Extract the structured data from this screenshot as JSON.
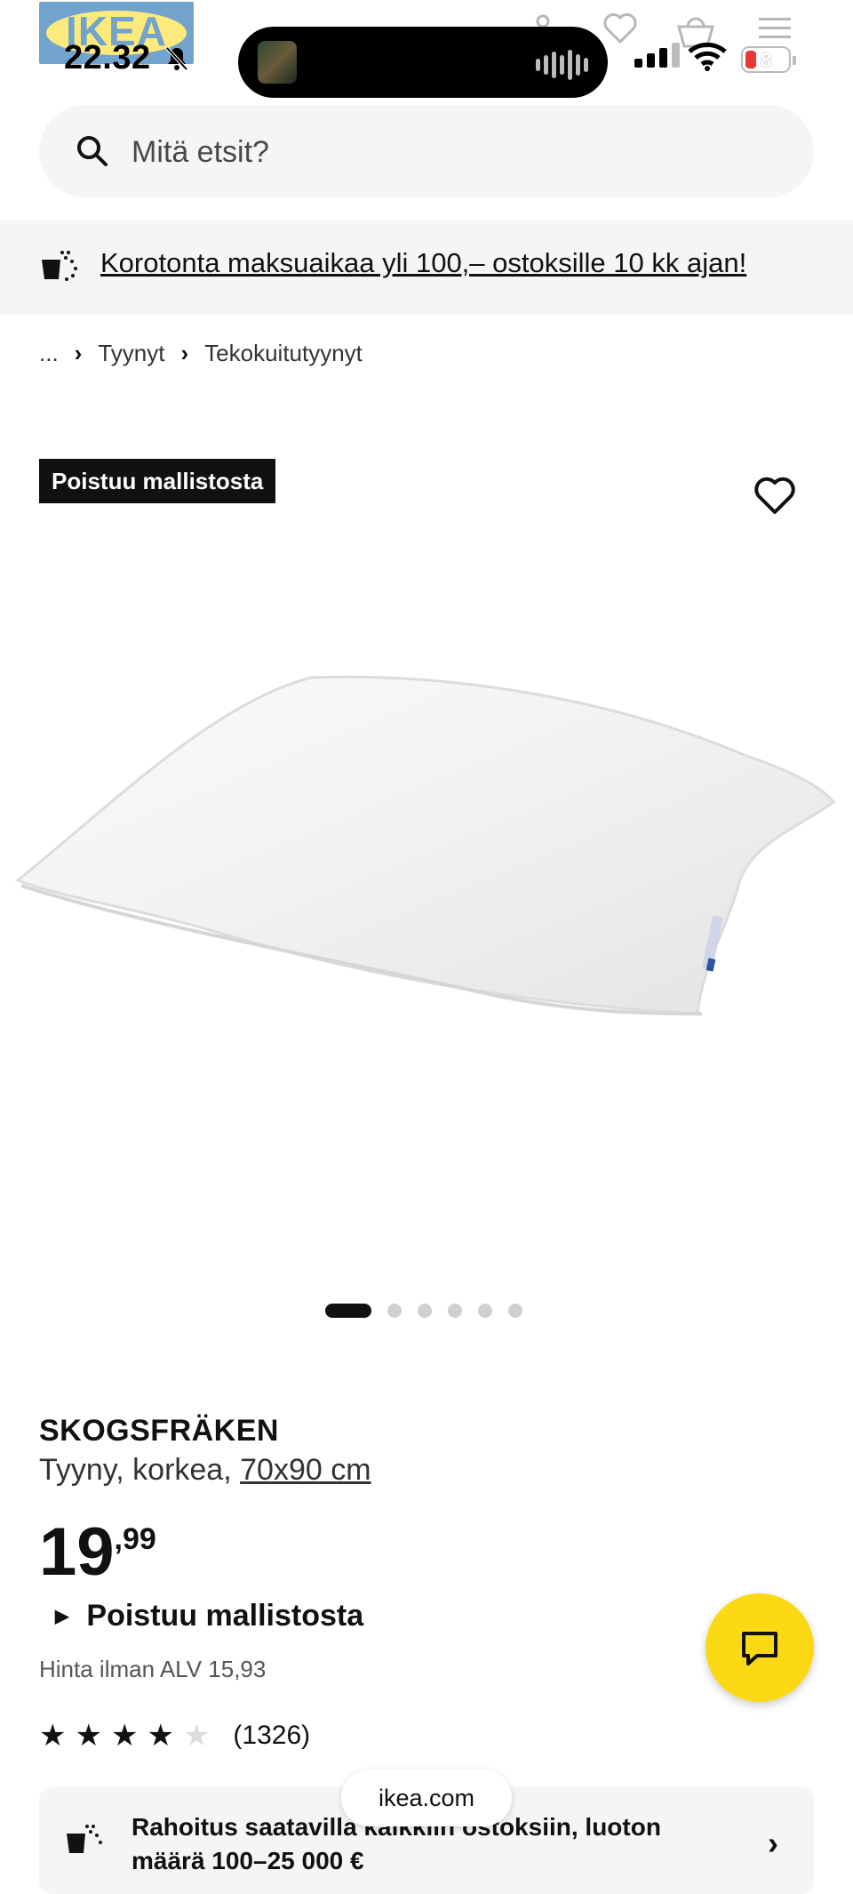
{
  "status_bar": {
    "time": "22.32",
    "battery": "8"
  },
  "header": {
    "logo_text": "IKEA"
  },
  "search": {
    "placeholder": "Mitä etsit?"
  },
  "promo": {
    "text": "Korotonta maksuaikaa yli 100,– ostoksille 10 kk ajan!"
  },
  "breadcrumb": {
    "ellipsis": "...",
    "items": [
      "Tyynyt",
      "Tekokuitutyynyt"
    ]
  },
  "product": {
    "badge": "Poistuu mallistosta",
    "name": "SKOGSFRÄKEN",
    "description": "Tyyny, korkea,",
    "size": "70x90 cm",
    "price_int": "19",
    "price_dec": ",99",
    "availability": "Poistuu mallistosta",
    "vat_text": "Hinta ilman ALV 15,93",
    "rating_value": 4.5,
    "rating_count": "(1326)"
  },
  "gallery": {
    "dots": 6,
    "active_index": 0
  },
  "finance": {
    "line1": "Rahoitus saatavilla kaikkiin ostoksiin, luoton",
    "line2": "määrä 100–25 000 €"
  },
  "browser": {
    "url": "ikea.com"
  },
  "colors": {
    "ikea_yellow": "#fbd914",
    "ikea_blue": "#0058a3",
    "text": "#111111",
    "surface": "#f5f5f5"
  }
}
